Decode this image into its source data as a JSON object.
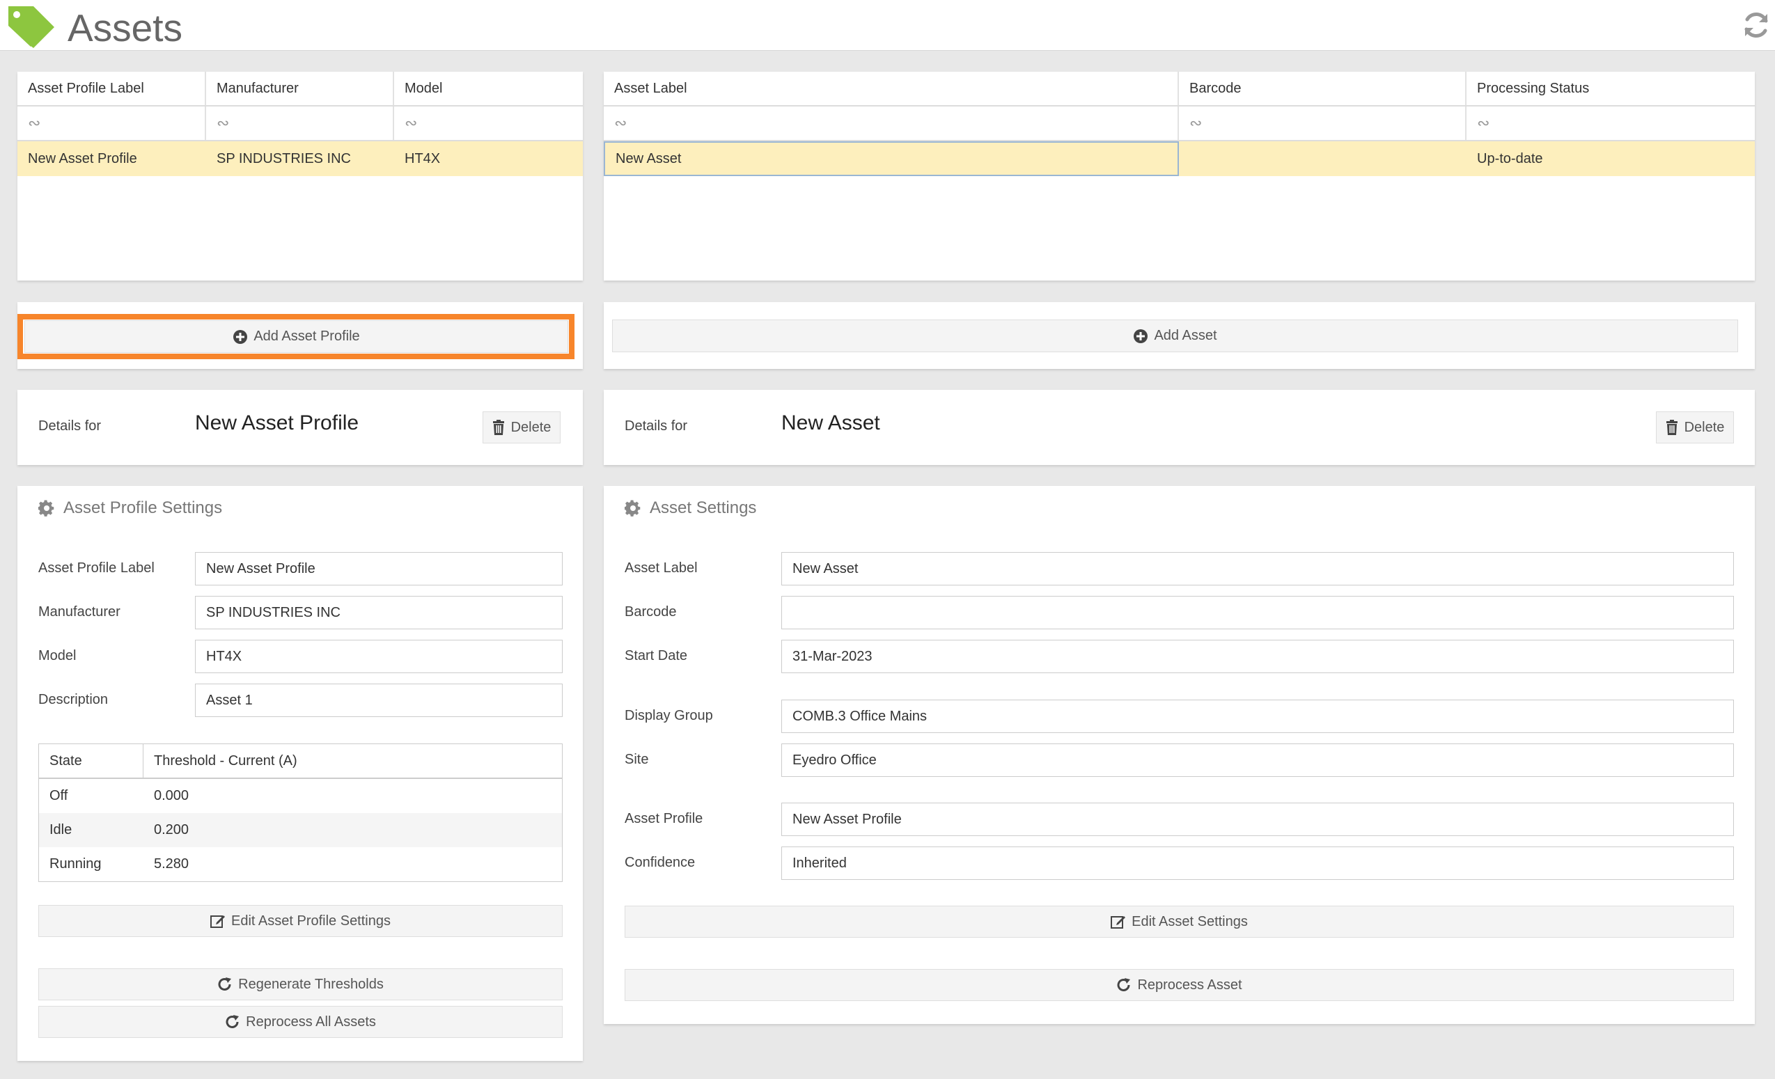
{
  "header": {
    "title": "Assets"
  },
  "profiles_table": {
    "columns": [
      "Asset Profile Label",
      "Manufacturer",
      "Model"
    ],
    "filter_glyph": "∾",
    "rows": [
      {
        "label": "New Asset Profile",
        "manufacturer": "SP INDUSTRIES INC",
        "model": "HT4X"
      }
    ]
  },
  "assets_table": {
    "columns": [
      "Asset Label",
      "Barcode",
      "Processing Status"
    ],
    "filter_glyph": "∾",
    "rows": [
      {
        "label": "New Asset",
        "barcode": "",
        "status": "Up-to-date"
      }
    ]
  },
  "buttons": {
    "add_asset_profile": "Add Asset Profile",
    "add_asset": "Add Asset",
    "delete": "Delete",
    "edit_asset_profile_settings": "Edit Asset Profile Settings",
    "regenerate_thresholds": "Regenerate Thresholds",
    "reprocess_all_assets": "Reprocess All Assets",
    "edit_asset_settings": "Edit Asset Settings",
    "reprocess_asset": "Reprocess Asset"
  },
  "profile_details": {
    "label": "Details for",
    "name": "New Asset Profile"
  },
  "asset_details": {
    "label": "Details for",
    "name": "New Asset"
  },
  "profile_settings": {
    "title": "Asset Profile Settings",
    "fields": {
      "label": {
        "label": "Asset Profile Label",
        "value": "New Asset Profile"
      },
      "manufacturer": {
        "label": "Manufacturer",
        "value": "SP INDUSTRIES INC"
      },
      "model": {
        "label": "Model",
        "value": "HT4X"
      },
      "description": {
        "label": "Description",
        "value": "Asset 1"
      }
    },
    "state_table": {
      "headers": [
        "State",
        "Threshold - Current (A)"
      ],
      "rows": [
        {
          "state": "Off",
          "threshold": "0.000"
        },
        {
          "state": "Idle",
          "threshold": "0.200"
        },
        {
          "state": "Running",
          "threshold": "5.280"
        }
      ]
    }
  },
  "asset_settings": {
    "title": "Asset Settings",
    "fields": {
      "label": {
        "label": "Asset Label",
        "value": "New Asset"
      },
      "barcode": {
        "label": "Barcode",
        "value": ""
      },
      "start_date": {
        "label": "Start Date",
        "value": "31-Mar-2023"
      },
      "display_group": {
        "label": "Display Group",
        "value": "COMB.3 Office Mains"
      },
      "site": {
        "label": "Site",
        "value": "Eyedro Office"
      },
      "asset_profile": {
        "label": "Asset Profile",
        "value": "New Asset Profile"
      },
      "confidence": {
        "label": "Confidence",
        "value": "Inherited"
      }
    }
  },
  "colors": {
    "selected_row": "#fdefbd",
    "highlight_border": "#f7852b",
    "logo_green": "#8dc63f",
    "background": "#e8e8e8"
  },
  "icons": [
    "tag-icon",
    "refresh-icon",
    "plus-circle-icon",
    "trash-icon",
    "gear-icon",
    "edit-icon",
    "redo-icon"
  ]
}
